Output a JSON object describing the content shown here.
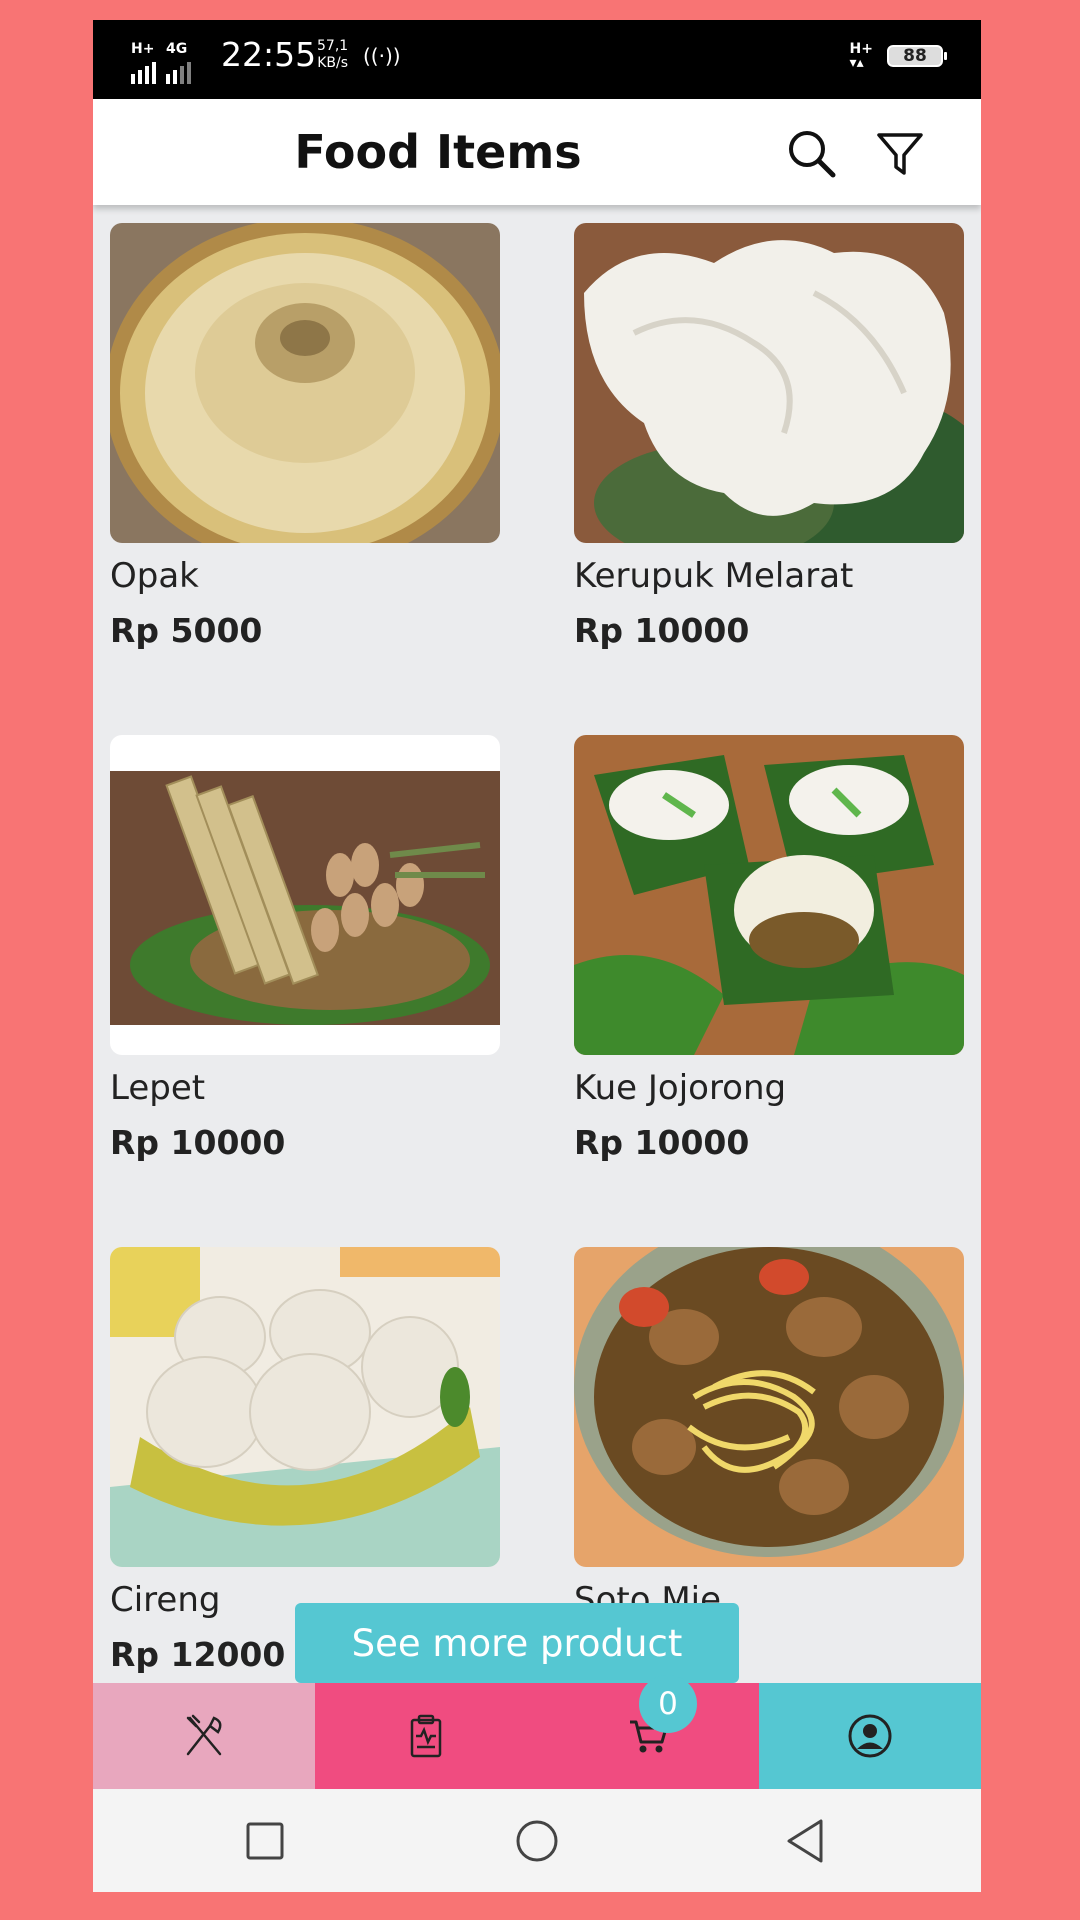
{
  "status_bar": {
    "network_left": "H+",
    "network_left2": "4G",
    "time": "22:55",
    "speed_value": "57,1",
    "speed_unit": "KB/s",
    "network_right": "H+",
    "battery": "88"
  },
  "header": {
    "title": "Food Items",
    "search_icon": "search-icon",
    "filter_icon": "filter-icon"
  },
  "products": [
    {
      "name": "Opak",
      "price": "Rp 5000"
    },
    {
      "name": "Kerupuk Melarat",
      "price": "Rp 10000"
    },
    {
      "name": "Lepet",
      "price": "Rp 10000"
    },
    {
      "name": "Kue Jojorong",
      "price": "Rp 10000"
    },
    {
      "name": "Cireng",
      "price": "Rp 12000"
    },
    {
      "name": "Soto Mie",
      "price": ""
    }
  ],
  "see_more_label": "See more product",
  "bottom_nav": {
    "tabs": [
      {
        "icon": "food-utensils-icon",
        "color": "#E8A7BE"
      },
      {
        "icon": "clipboard-icon",
        "color": "#F04C80"
      },
      {
        "icon": "cart-icon",
        "color": "#F04C80"
      },
      {
        "icon": "account-icon",
        "color": "#55C7D2"
      }
    ],
    "cart_count": "0"
  },
  "colors": {
    "background": "#F87474",
    "accent": "#55C7D2",
    "pink": "#F04C80",
    "light_pink": "#E8A7BE"
  }
}
